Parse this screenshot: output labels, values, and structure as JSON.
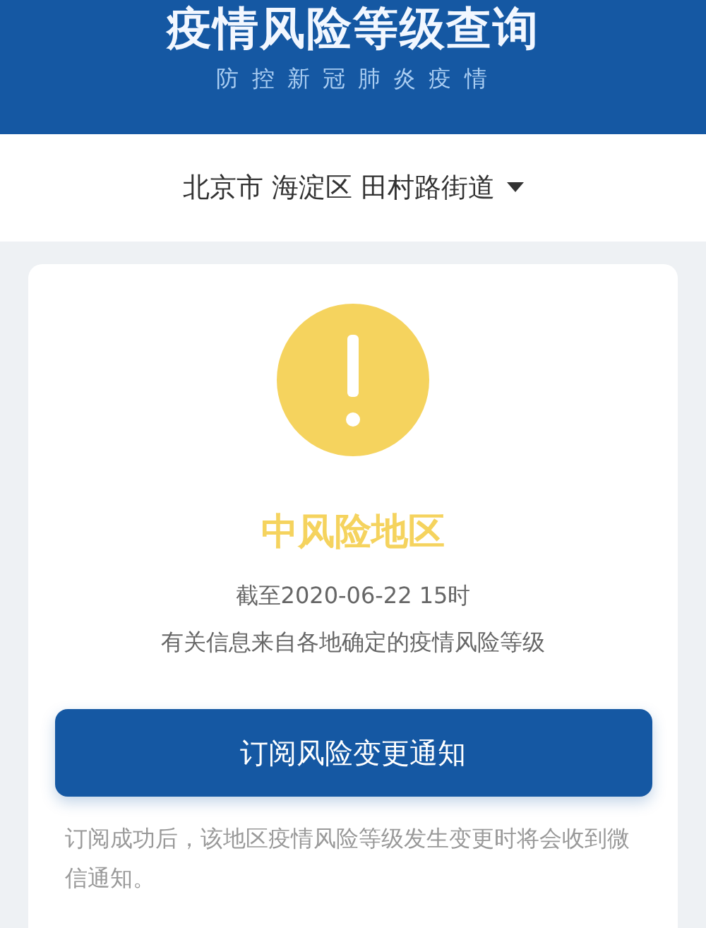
{
  "header": {
    "title": "疫情风险等级查询",
    "subtitle": "防 控 新 冠 肺 炎 疫 情"
  },
  "location": {
    "parts": [
      "北京市",
      "海淀区",
      "田村路街道"
    ]
  },
  "result": {
    "kind": "medium",
    "label": "中风险地区",
    "as_of": "截至2020-06-22 15时",
    "source": "有关信息来自各地确定的疫情风险等级"
  },
  "subscribe_button": "订阅风险变更通知",
  "note": "订阅成功后，该地区疫情风险等级发生变更时将会收到微信通知。"
}
